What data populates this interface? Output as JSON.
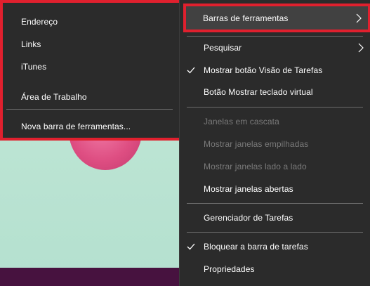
{
  "submenu": {
    "items": [
      {
        "label": "Endereço"
      },
      {
        "label": "Links"
      },
      {
        "label": "iTunes"
      },
      {
        "label": "Área de Trabalho"
      },
      {
        "label": "Nova barra de ferramentas..."
      }
    ]
  },
  "context_menu": {
    "toolbars": {
      "label": "Barras de ferramentas",
      "icon": "chevron-right-icon"
    },
    "search": {
      "label": "Pesquisar",
      "icon": "chevron-right-icon"
    },
    "task_view": {
      "label": "Mostrar botão Visão de Tarefas",
      "checked": true
    },
    "touch_keyboard": {
      "label": "Botão Mostrar teclado virtual"
    },
    "cascade": {
      "label": "Janelas em cascata",
      "enabled": false
    },
    "stacked": {
      "label": "Mostrar janelas empilhadas",
      "enabled": false
    },
    "side_by_side": {
      "label": "Mostrar janelas lado a lado",
      "enabled": false
    },
    "show_desktop": {
      "label": "Mostrar janelas abertas"
    },
    "task_manager": {
      "label": "Gerenciador de Tarefas"
    },
    "lock_taskbar": {
      "label": "Bloquear a barra de tarefas",
      "checked": true
    },
    "properties": {
      "label": "Propriedades"
    }
  },
  "colors": {
    "menu_bg": "#2b2b2b",
    "highlight_border": "#e0202e",
    "hover_bg": "#414141",
    "disabled_text": "#7a7a7a",
    "taskbar": "#47123f"
  }
}
